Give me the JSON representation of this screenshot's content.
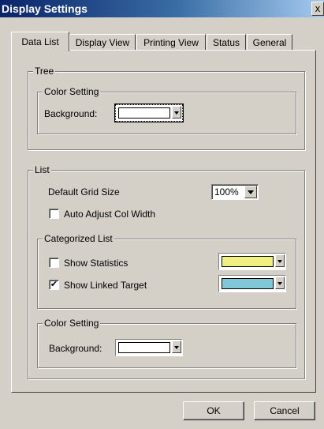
{
  "window": {
    "title": "Display Settings",
    "close_label": "x"
  },
  "tabs": [
    {
      "label": "Data List",
      "active": true
    },
    {
      "label": "Display View",
      "active": false
    },
    {
      "label": "Printing View",
      "active": false
    },
    {
      "label": "Status",
      "active": false
    },
    {
      "label": "General",
      "active": false
    }
  ],
  "tree": {
    "legend": "Tree",
    "color_setting": {
      "legend": "Color Setting",
      "background_label": "Background:",
      "background_color": "#ffffff"
    }
  },
  "list": {
    "legend": "List",
    "grid_size_label": "Default Grid Size",
    "grid_size_value": "100%",
    "auto_adjust_label": "Auto Adjust Col Width",
    "auto_adjust_checked": false,
    "categorized": {
      "legend": "Categorized List",
      "show_statistics_label": "Show Statistics",
      "show_statistics_checked": false,
      "statistics_color": "#f0f080",
      "show_linked_label": "Show Linked Target",
      "show_linked_checked": true,
      "linked_color": "#80c8d8"
    },
    "color_setting": {
      "legend": "Color Setting",
      "background_label": "Background:",
      "background_color": "#ffffff"
    }
  },
  "buttons": {
    "ok": "OK",
    "cancel": "Cancel"
  },
  "check_glyph": "✔"
}
